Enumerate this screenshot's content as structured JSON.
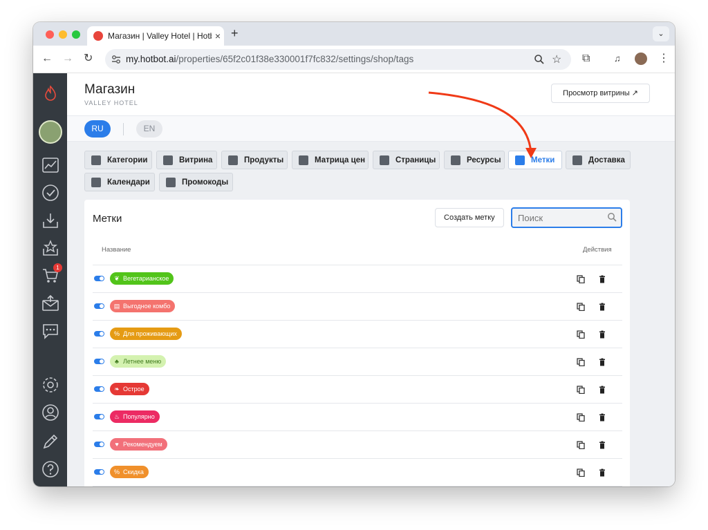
{
  "browser": {
    "tab_title": "Магазин | Valley Hotel | Hotbot",
    "url_prefix": "my.hotbot.ai",
    "url_path": "/properties/65f2c01f38e330001f7fc832/settings/shop/tags"
  },
  "header": {
    "title": "Магазин",
    "subtitle": "VALLEY HOTEL",
    "preview_button": "Просмотр витрины ↗"
  },
  "languages": {
    "ru": "RU",
    "en": "EN"
  },
  "tabs": [
    {
      "label": "Категории"
    },
    {
      "label": "Витрина"
    },
    {
      "label": "Продукты"
    },
    {
      "label": "Матрица цен"
    },
    {
      "label": "Страницы"
    },
    {
      "label": "Ресурсы"
    },
    {
      "label": "Метки"
    },
    {
      "label": "Доставка"
    },
    {
      "label": "Календари"
    },
    {
      "label": "Промокоды"
    }
  ],
  "sidebar": {
    "cart_badge": "1"
  },
  "tags_panel": {
    "title": "Метки",
    "create_button": "Создать метку",
    "search_placeholder": "Поиск",
    "col_name": "Название",
    "col_actions": "Действия",
    "rows": [
      {
        "name": "Вегетарианское",
        "color": "#52c41a",
        "icon": "leaf-icon"
      },
      {
        "name": "Выгодное комбо",
        "color": "#f4736e",
        "icon": "combo-icon"
      },
      {
        "name": "Для проживающих",
        "color": "#e59b14",
        "icon": "percent-icon"
      },
      {
        "name": "Летнее меню",
        "color": "#d4f2b0",
        "icon": "sprout-icon"
      },
      {
        "name": "Острое",
        "color": "#e53935",
        "icon": "chili-icon"
      },
      {
        "name": "Популярно",
        "color": "#ec2b63",
        "icon": "fire-icon"
      },
      {
        "name": "Рекомендуем",
        "color": "#f2707a",
        "icon": "heart-icon"
      },
      {
        "name": "Скидка",
        "color": "#f0902b",
        "icon": "percent-icon"
      }
    ]
  }
}
